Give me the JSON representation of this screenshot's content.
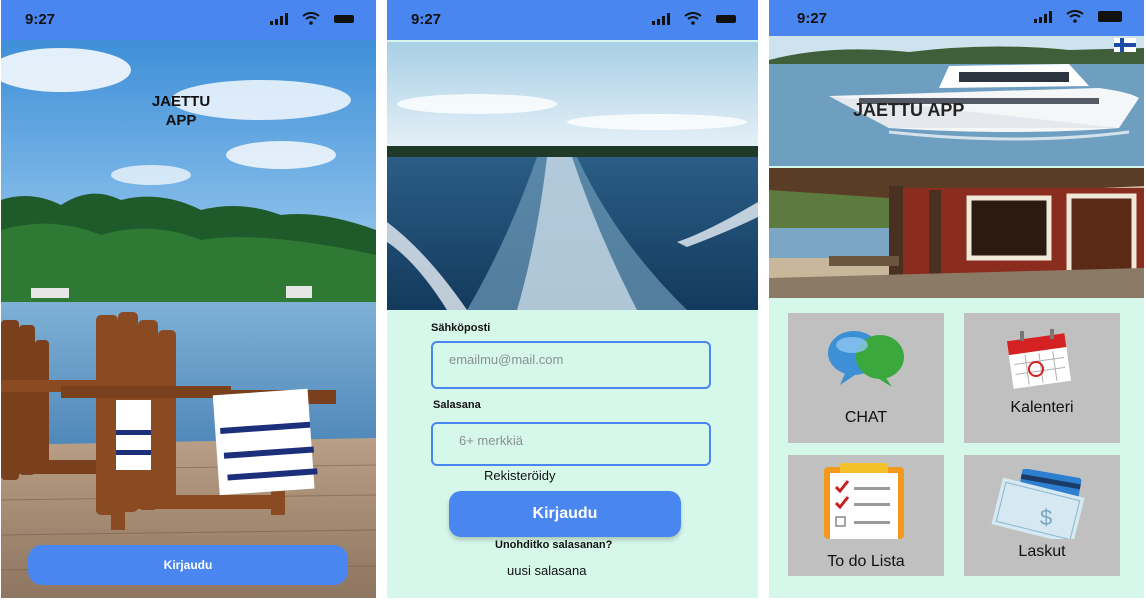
{
  "status_bar": {
    "time": "9:27"
  },
  "screen1": {
    "title_line1": "JAETTU",
    "title_line2": "APP",
    "login_button": "Kirjaudu"
  },
  "screen2": {
    "email_label": "Sähköposti",
    "email_placeholder": "emailmu@mail.com",
    "password_label": "Salasana",
    "password_placeholder": "6+ merkkiä",
    "register_link": "Rekisteröidy",
    "login_button": "Kirjaudu",
    "forgot_password": "Unohditko salasanan?",
    "new_password": "uusi salasana"
  },
  "screen3": {
    "title": "JAETTU APP",
    "tiles": [
      {
        "label": "CHAT",
        "icon": "chat-bubbles-icon"
      },
      {
        "label": "Kalenteri",
        "icon": "calendar-icon"
      },
      {
        "label": "To do Lista",
        "icon": "checklist-icon"
      },
      {
        "label": "Laskut",
        "icon": "bills-icon"
      }
    ]
  },
  "colors": {
    "accent": "#4a86f0",
    "mint_background": "#d6f8ea",
    "tile": "#c0c0c0"
  }
}
